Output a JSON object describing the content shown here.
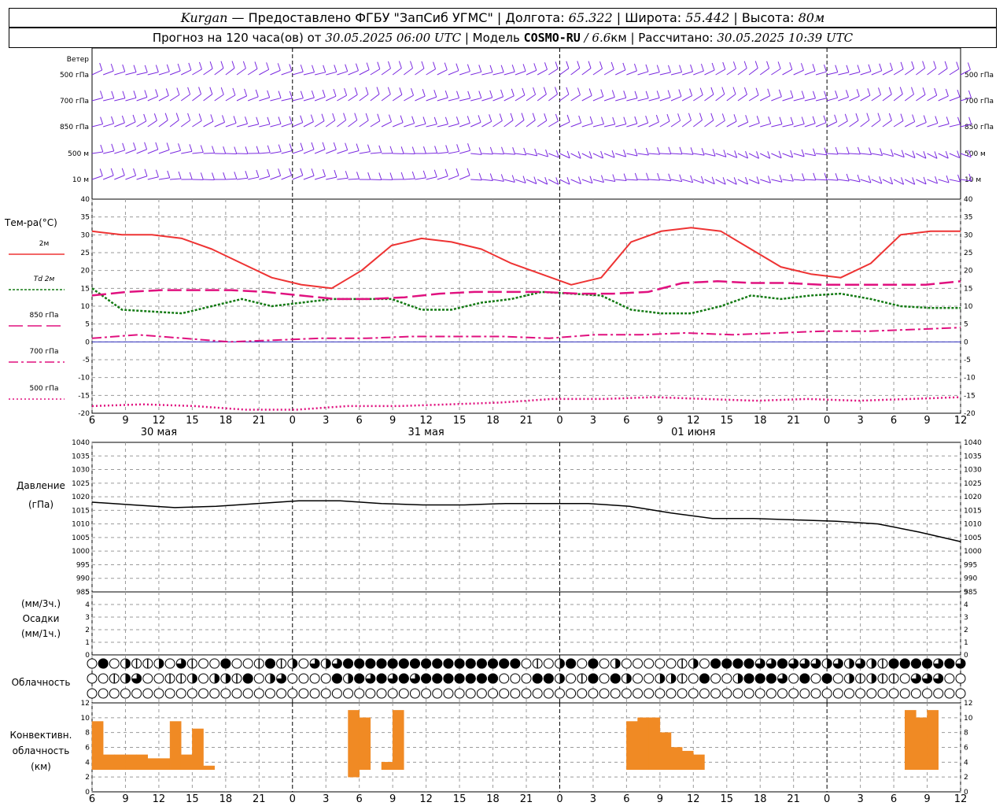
{
  "header": {
    "city": "Kurgan",
    "dash": " — ",
    "provider": "Предоставлено ФГБУ \"ЗапСиб УГМС\"",
    "sep": " | ",
    "lon_label": "Долгота: ",
    "lon": "65.322",
    "lat_label": "Широта: ",
    "lat": "55.442",
    "alt_label": "Высота: ",
    "alt": "80м",
    "forecast_prefix": "Прогноз на 120 часа(ов) от ",
    "forecast_time": "30.05.2025 06:00 UTC",
    "model_label": "Модель ",
    "model": "COSMO-RU",
    "model_res": " / 6.6",
    "model_res_unit": "км",
    "calc_label": "Рассчитано: ",
    "calc_time": "30.05.2025 10:39 UTC"
  },
  "colors": {
    "grid": "#9a9a9a",
    "day_line": "#000000",
    "wind": "#7b2be0",
    "t2m": "#ee3333",
    "td2m": "#137a13",
    "t850": "#e0117f",
    "pressure": "#000000",
    "convective": "#f08a24",
    "zero_line": "#3030c0"
  },
  "chart_data": [
    {
      "type": "wind_barbs",
      "label": "Ветер",
      "levels": [
        "500 гПа",
        "700 гПа",
        "850 гПа",
        "500 м",
        "10 м"
      ],
      "note": "barbs every hour from 30.05 06 UTC to 01.06 12 UTC"
    },
    {
      "type": "line",
      "label": "Тем-ра(°С)",
      "ylim": [
        -20,
        40
      ],
      "yticks": [
        40,
        35,
        30,
        25,
        20,
        15,
        10,
        5,
        0,
        -5,
        -10,
        -15,
        -20
      ],
      "legend": [
        {
          "name": "2м",
          "key": "t2m",
          "style": "solid"
        },
        {
          "name": "Td  2м",
          "key": "td2m",
          "style": "dotted"
        },
        {
          "name": "850 гПа",
          "key": "t850",
          "style": "long-dash"
        },
        {
          "name": "700 гПа",
          "key": "t700",
          "style": "dash-dot"
        },
        {
          "name": "500 гПа",
          "key": "t500",
          "style": "dotted"
        }
      ],
      "x_hours": [
        0,
        3,
        6,
        9,
        12,
        15,
        18,
        21,
        24,
        27,
        30,
        33,
        36,
        39,
        42,
        45,
        48,
        51,
        54,
        57,
        60,
        63,
        66,
        69,
        72,
        75,
        78
      ],
      "series": [
        {
          "key": "t2m",
          "values": [
            31,
            30,
            30,
            29,
            26,
            22,
            18,
            16,
            15,
            20,
            27,
            29,
            28,
            26,
            22,
            19,
            16,
            18,
            28,
            31,
            32,
            31,
            26,
            21,
            19,
            18,
            22,
            30,
            31,
            31
          ]
        },
        {
          "key": "td2m",
          "values": [
            15,
            9,
            8.5,
            8,
            10,
            12,
            10,
            11,
            12,
            12,
            12,
            9,
            9,
            11,
            12,
            14,
            13.5,
            13,
            9,
            8,
            8,
            10,
            13,
            12,
            13,
            13.5,
            12,
            10,
            9.5,
            9.5
          ]
        },
        {
          "key": "t850",
          "values": [
            13,
            14,
            14.5,
            14.5,
            14.5,
            14,
            13,
            12,
            12,
            12.5,
            13.5,
            14,
            14,
            14,
            13.5,
            13.5,
            14,
            16.5,
            17,
            16.5,
            16.5,
            16,
            16,
            16,
            16,
            17
          ]
        },
        {
          "key": "t700",
          "values": [
            1,
            2,
            1,
            0,
            0.5,
            1,
            1,
            1.5,
            1.5,
            1.5,
            1,
            2,
            2,
            2.5,
            2,
            2.5,
            3,
            3,
            3.5,
            4
          ]
        },
        {
          "key": "t500",
          "values": [
            -18,
            -17.5,
            -18,
            -19,
            -19,
            -18,
            -18,
            -17.5,
            -17,
            -16,
            -16,
            -15.5,
            -16,
            -16.5,
            -16,
            -16.5,
            -16,
            -15.5
          ]
        }
      ]
    },
    {
      "type": "line",
      "label": "Давление",
      "unit": "(гПа)",
      "ylim": [
        985,
        1040
      ],
      "yticks": [
        1040,
        1035,
        1030,
        1025,
        1020,
        1015,
        1010,
        1005,
        1000,
        995,
        990,
        985
      ],
      "series": [
        {
          "key": "pressure",
          "values": [
            1018,
            1017,
            1016,
            1016.5,
            1017.5,
            1018.5,
            1018.5,
            1017.5,
            1017,
            1017,
            1017.5,
            1017.5,
            1017.5,
            1016.5,
            1014,
            1012,
            1012,
            1011.5,
            1011,
            1010,
            1007,
            1003.5
          ]
        }
      ]
    },
    {
      "type": "bar",
      "label": "Осадки",
      "unit_top": "(мм/3ч.)",
      "unit_bottom": "(мм/1ч.)",
      "ylim": [
        0,
        5
      ],
      "yticks": [
        5,
        4,
        3,
        2,
        1,
        0
      ],
      "values": []
    },
    {
      "type": "cloud_symbols",
      "label": "Облачность",
      "rows": 3
    },
    {
      "type": "bar",
      "label_lines": [
        "Конвективн.",
        "облачность",
        "(км)"
      ],
      "ylim": [
        0,
        12
      ],
      "yticks": [
        12,
        10,
        8,
        6,
        4,
        2,
        0
      ],
      "bars": [
        {
          "h": 0.5,
          "base": 3,
          "top": 9.5
        },
        {
          "h": 1.5,
          "base": 3,
          "top": 5
        },
        {
          "h": 2.5,
          "base": 3,
          "top": 5
        },
        {
          "h": 3.5,
          "base": 3,
          "top": 5
        },
        {
          "h": 4.5,
          "base": 3,
          "top": 5
        },
        {
          "h": 5.5,
          "base": 3,
          "top": 4.5
        },
        {
          "h": 6.5,
          "base": 3,
          "top": 4.5
        },
        {
          "h": 7.5,
          "base": 3,
          "top": 9.5
        },
        {
          "h": 8.5,
          "base": 3,
          "top": 5
        },
        {
          "h": 9.5,
          "base": 3,
          "top": 8.5
        },
        {
          "h": 10.5,
          "base": 3,
          "top": 3.5
        },
        {
          "h": 23.5,
          "base": 2,
          "top": 11
        },
        {
          "h": 24.5,
          "base": 3,
          "top": 10
        },
        {
          "h": 26.5,
          "base": 3,
          "top": 4
        },
        {
          "h": 27.5,
          "base": 3,
          "top": 11
        },
        {
          "h": 48.5,
          "base": 3,
          "top": 9.5
        },
        {
          "h": 49.5,
          "base": 3,
          "top": 10
        },
        {
          "h": 50.5,
          "base": 3,
          "top": 10
        },
        {
          "h": 51.5,
          "base": 3,
          "top": 8
        },
        {
          "h": 52.5,
          "base": 3,
          "top": 6
        },
        {
          "h": 53.5,
          "base": 3,
          "top": 5.5
        },
        {
          "h": 54.5,
          "base": 3,
          "top": 5
        },
        {
          "h": 73.5,
          "base": 3,
          "top": 11
        },
        {
          "h": 74.5,
          "base": 3,
          "top": 10
        },
        {
          "h": 75.5,
          "base": 3,
          "top": 11
        }
      ]
    }
  ],
  "x_axis": {
    "tick_labels": [
      "6",
      "9",
      "12",
      "15",
      "18",
      "21",
      "0",
      "3",
      "6",
      "9",
      "12",
      "15",
      "18",
      "21",
      "0",
      "3",
      "6",
      "9",
      "12",
      "15",
      "18",
      "21",
      "0",
      "3",
      "6",
      "9",
      "12"
    ],
    "day_labels": [
      {
        "text": "30 мая",
        "at_hour": 6
      },
      {
        "text": "31 мая",
        "at_hour": 30
      },
      {
        "text": "01 июня",
        "at_hour": 54
      }
    ]
  }
}
